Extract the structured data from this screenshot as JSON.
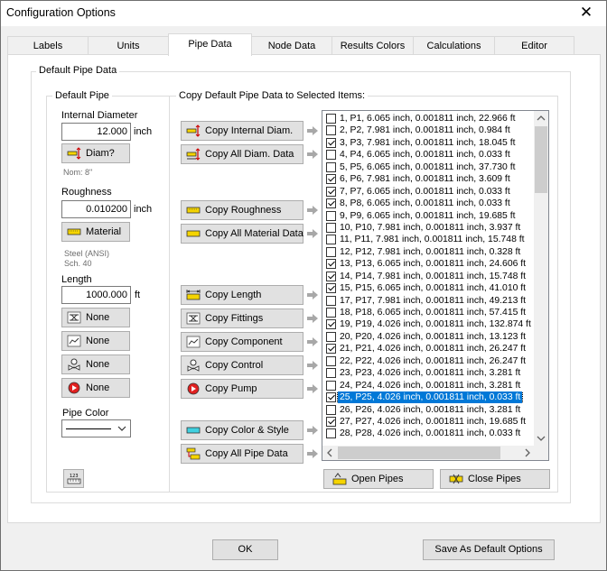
{
  "window": {
    "title": "Configuration Options",
    "close": "✕"
  },
  "tabs": [
    {
      "label": "Labels"
    },
    {
      "label": "Units"
    },
    {
      "label": "Pipe Data"
    },
    {
      "label": "Node Data"
    },
    {
      "label": "Results Colors"
    },
    {
      "label": "Calculations"
    },
    {
      "label": "Editor"
    }
  ],
  "default_pipe_data": {
    "group_label": "Default Pipe Data"
  },
  "default_pipe": {
    "group_label": "Default Pipe",
    "internal_diameter_label": "Internal Diameter",
    "internal_diameter_value": "12.000",
    "internal_diameter_unit": "inch",
    "diam_button": "Diam?",
    "nominal": "Nom: 8\"",
    "roughness_label": "Roughness",
    "roughness_value": "0.010200",
    "roughness_unit": "inch",
    "material_button": "Material",
    "material_line1": "Steel (ANSI)",
    "material_line2": "Sch. 40",
    "length_label": "Length",
    "length_value": "1000.000",
    "length_unit": "ft",
    "fittings_button": "None",
    "component_button": "None",
    "control_button": "None",
    "pump_button": "None",
    "pipe_color_label": "Pipe Color"
  },
  "copy_group": {
    "label": "Copy Default Pipe Data to Selected Items:",
    "buttons": {
      "internal_diam": "Copy Internal Diam.",
      "all_diam": "Copy All Diam. Data",
      "roughness": "Copy Roughness",
      "all_material": "Copy All Material Data",
      "length": "Copy Length",
      "fittings": "Copy Fittings",
      "component": "Copy Component",
      "control": "Copy Control",
      "pump": "Copy Pump",
      "color_style": "Copy Color & Style",
      "all_pipe": "Copy All Pipe Data"
    },
    "open_pipes": "Open Pipes",
    "close_pipes": "Close Pipes"
  },
  "pipes": [
    {
      "text": "1, P1, 6.065 inch, 0.001811 inch, 22.966 ft",
      "checked": false
    },
    {
      "text": "2, P2, 7.981 inch, 0.001811 inch, 0.984 ft",
      "checked": false
    },
    {
      "text": "3, P3, 7.981 inch, 0.001811 inch, 18.045 ft",
      "checked": true
    },
    {
      "text": "4, P4, 6.065 inch, 0.001811 inch, 0.033 ft",
      "checked": false
    },
    {
      "text": "5, P5, 6.065 inch, 0.001811 inch, 37.730 ft",
      "checked": false
    },
    {
      "text": "6, P6, 7.981 inch, 0.001811 inch, 3.609 ft",
      "checked": true
    },
    {
      "text": "7, P7, 6.065 inch, 0.001811 inch, 0.033 ft",
      "checked": true
    },
    {
      "text": "8, P8, 6.065 inch, 0.001811 inch, 0.033 ft",
      "checked": true
    },
    {
      "text": "9, P9, 6.065 inch, 0.001811 inch, 19.685 ft",
      "checked": false
    },
    {
      "text": "10, P10, 7.981 inch, 0.001811 inch, 3.937 ft",
      "checked": false
    },
    {
      "text": "11, P11, 7.981 inch, 0.001811 inch, 15.748 ft",
      "checked": false
    },
    {
      "text": "12, P12, 7.981 inch, 0.001811 inch, 0.328 ft",
      "checked": false
    },
    {
      "text": "13, P13, 6.065 inch, 0.001811 inch, 24.606 ft",
      "checked": true
    },
    {
      "text": "14, P14, 7.981 inch, 0.001811 inch, 15.748 ft",
      "checked": true
    },
    {
      "text": "15, P15, 6.065 inch, 0.001811 inch, 41.010 ft",
      "checked": true
    },
    {
      "text": "17, P17, 7.981 inch, 0.001811 inch, 49.213 ft",
      "checked": false
    },
    {
      "text": "18, P18, 6.065 inch, 0.001811 inch, 57.415 ft",
      "checked": false
    },
    {
      "text": "19, P19, 4.026 inch, 0.001811 inch, 132.874 ft",
      "checked": true
    },
    {
      "text": "20, P20, 4.026 inch, 0.001811 inch, 13.123 ft",
      "checked": false
    },
    {
      "text": "21, P21, 4.026 inch, 0.001811 inch, 26.247 ft",
      "checked": true
    },
    {
      "text": "22, P22, 4.026 inch, 0.001811 inch, 26.247 ft",
      "checked": false
    },
    {
      "text": "23, P23, 4.026 inch, 0.001811 inch, 3.281 ft",
      "checked": false
    },
    {
      "text": "24, P24, 4.026 inch, 0.001811 inch, 3.281 ft",
      "checked": false
    },
    {
      "text": "25, P25, 4.026 inch, 0.001811 inch, 0.033 ft",
      "checked": true,
      "selected": true
    },
    {
      "text": "26, P26, 4.026 inch, 0.001811 inch, 3.281 ft",
      "checked": false
    },
    {
      "text": "27, P27, 4.026 inch, 0.001811 inch, 19.685 ft",
      "checked": true
    },
    {
      "text": "28, P28, 4.026 inch, 0.001811 inch, 0.033 ft",
      "checked": false
    }
  ],
  "footer": {
    "ok": "OK",
    "save_default": "Save As Default Options"
  }
}
